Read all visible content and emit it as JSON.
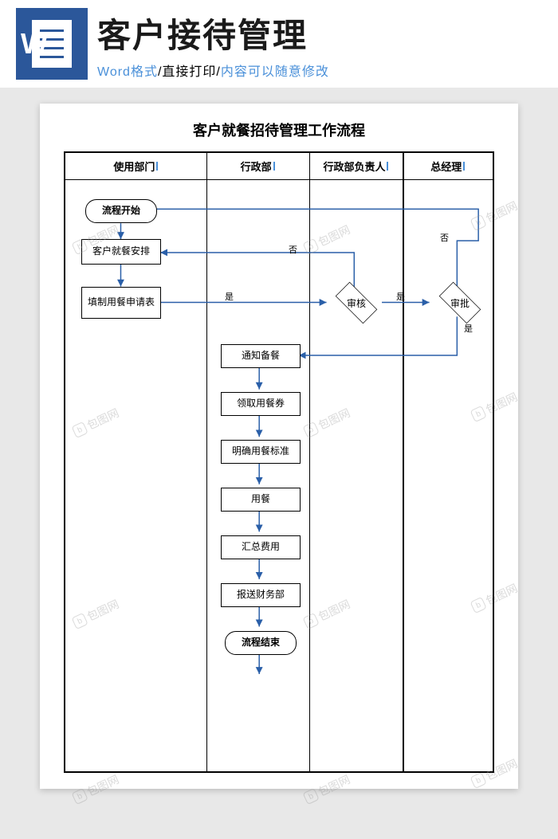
{
  "header": {
    "title": "客户接待管理",
    "subtitle_parts": [
      "Word格式",
      "/直接打印/",
      "内容可以随意修改"
    ]
  },
  "document": {
    "title": "客户就餐招待管理工作流程",
    "columns": [
      "使用部门",
      "行政部",
      "行政部负责人",
      "总经理"
    ],
    "nodes": {
      "start": "流程开始",
      "arrange": "客户就餐安排",
      "form": "填制用餐申请表",
      "review1": "审核",
      "review2": "审批",
      "notify": "通知备餐",
      "coupon": "领取用餐券",
      "standard": "明确用餐标准",
      "dine": "用餐",
      "cost": "汇总费用",
      "submit": "报送财务部",
      "end": "流程结束"
    },
    "labels": {
      "yes": "是",
      "no": "否"
    }
  },
  "watermark": "包图网"
}
